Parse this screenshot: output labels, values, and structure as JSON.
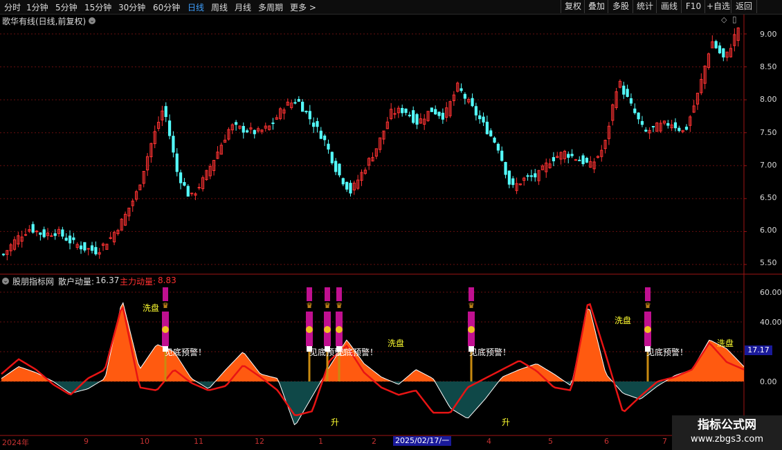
{
  "toolbar": {
    "timeframes": [
      "分时",
      "1分钟",
      "5分钟",
      "15分钟",
      "30分钟",
      "60分钟",
      "日线",
      "周线",
      "月线",
      "多周期",
      "更多 >"
    ],
    "active": "日线",
    "right_buttons": [
      "复权",
      "叠加",
      "多股",
      "统计",
      "画线",
      "F10",
      "+自选",
      "返回"
    ]
  },
  "main_panel": {
    "title": "歌华有线(日线,前复权)",
    "y_ticks": [
      "9.00",
      "8.50",
      "8.00",
      "7.50",
      "7.00",
      "6.50",
      "6.00",
      "5.50"
    ]
  },
  "indicator_panel": {
    "name": "股朋指标网",
    "retail_label": "散户动量:",
    "retail_value": "16.37",
    "main_label": "主力动量:",
    "main_value": "8.83",
    "y_ticks": [
      "60.00",
      "40.00",
      "20.00",
      "0.00"
    ],
    "current_value": "17.17",
    "signals": {
      "wash": "洗盘",
      "bottom": "见底预警！",
      "rise": "升"
    }
  },
  "x_axis": {
    "labels": [
      "2024年",
      "9",
      "10",
      "11",
      "12",
      "1",
      "2",
      "4",
      "5",
      "6",
      "7"
    ],
    "cursor_date": "2025/02/17/一"
  },
  "watermark": {
    "line1": "指标公式网",
    "line2": "www.zbgs3.com"
  },
  "colors": {
    "up": "#ff3232",
    "down": "#54ffff",
    "grid": "#6a0f0f",
    "frame": "#a01414",
    "area": "#ff5a10",
    "area_neg": "#0f4848",
    "retail_line": "#e81414",
    "accent": "#3fa0ff"
  },
  "chart_data": {
    "type": "candlestick",
    "title": "歌华有线(日线,前复权)",
    "ylim": [
      5.4,
      9.2
    ],
    "price_anchors": [
      5.65,
      5.9,
      6.05,
      5.95,
      6.0,
      5.85,
      5.75,
      5.7,
      5.9,
      6.2,
      6.6,
      7.3,
      7.9,
      6.9,
      6.5,
      6.8,
      7.2,
      7.6,
      7.55,
      7.5,
      7.6,
      7.9,
      8.0,
      7.7,
      7.4,
      6.9,
      6.6,
      6.95,
      7.3,
      7.8,
      7.85,
      7.65,
      7.85,
      7.75,
      8.2,
      7.9,
      7.6,
      7.3,
      6.65,
      6.8,
      6.85,
      7.1,
      7.2,
      7.1,
      7.0,
      7.3,
      8.3,
      7.9,
      7.5,
      7.6,
      7.65,
      7.5,
      8.1,
      8.9,
      8.6,
      9.1
    ],
    "indicator": {
      "ylim": [
        -25,
        65
      ],
      "retail_anchors": [
        2,
        10,
        6,
        0,
        -8,
        -5,
        2,
        55,
        8,
        25,
        20,
        2,
        -5,
        8,
        20,
        5,
        2,
        -30,
        -10,
        10,
        28,
        12,
        3,
        -2,
        8,
        2,
        -18,
        -25,
        -12,
        3,
        8,
        12,
        5,
        -3,
        52,
        5,
        -8,
        -12,
        -3,
        4,
        8,
        28,
        22,
        10
      ],
      "main_anchors": [
        5,
        15,
        8,
        -2,
        -9,
        2,
        8,
        52,
        -4,
        -6,
        8,
        -1,
        -6,
        -3,
        11,
        3,
        -6,
        -23,
        -20,
        14,
        24,
        6,
        -4,
        -9,
        -6,
        -21,
        -21,
        -4,
        2,
        8,
        14,
        7,
        -4,
        -6,
        55,
        18,
        -21,
        -10,
        0,
        3,
        8,
        26,
        13,
        8
      ]
    }
  }
}
